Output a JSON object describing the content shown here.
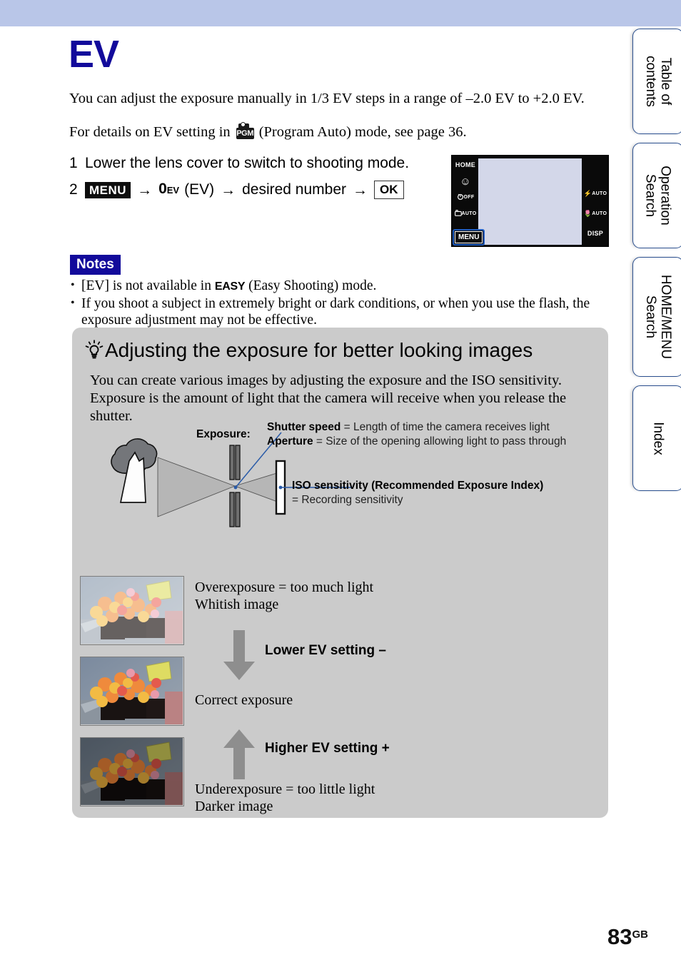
{
  "document": {
    "title": "EV",
    "page_number": "83",
    "page_region_suffix": "GB"
  },
  "intro": {
    "paragraph": "You can adjust the exposure manually in 1/3 EV steps in a range of –2.0 EV to +2.0 EV.",
    "pgm_prefix": "For details on EV setting in",
    "pgm_icon_label": "PGM",
    "pgm_suffix": "(Program Auto) mode, see page 36."
  },
  "steps": [
    {
      "num": "1",
      "text": "Lower the lens cover to switch to shooting mode."
    },
    {
      "num": "2",
      "menu_label": "MENU",
      "arrow": "→",
      "ev_zero": "0",
      "ev_unit": "EV",
      "ev_paren": "(EV)",
      "desired": "desired number",
      "ok_label": "OK"
    }
  ],
  "camera_screen": {
    "home_label": "HOME",
    "smile_label": "☺",
    "timer_label": "OFF",
    "burst_label": "AUTO",
    "flash_label": "AUTO",
    "macro_label": "AUTO",
    "disp_label": "DISP",
    "menu_label": "MENU"
  },
  "notes": {
    "heading": "Notes",
    "items": [
      "[EV] is not available in  (Easy Shooting) mode.",
      "If you shoot a subject in extremely bright or dark conditions, or when you use the flash, the exposure adjustment may not be effective."
    ],
    "note1_prefix": "[EV] is not available in",
    "note1_badge": "EASY",
    "note1_suffix": "(Easy Shooting) mode.",
    "note2": "If you shoot a subject in extremely bright or dark conditions, or when you use the flash, the exposure adjustment may not be effective."
  },
  "tip": {
    "title": "Adjusting the exposure for better looking images",
    "body": "You can create various images by adjusting the exposure and the ISO sensitivity. Exposure is the amount of light that the camera will receive when you release the shutter.",
    "diagram": {
      "exposure_label": "Exposure:",
      "shutter_bold": "Shutter speed",
      "shutter_rest": " = Length of time the camera receives light",
      "aperture_bold": "Aperture",
      "aperture_rest": " = Size of the opening allowing light to pass through",
      "iso_bold": "ISO sensitivity (Recommended Exposure Index)",
      "iso_rest": "= Recording sensitivity"
    },
    "examples": [
      {
        "caption_line1": "Overexposure = too much light",
        "caption_line2": "Whitish image"
      },
      {
        "caption_line1": "Correct exposure",
        "caption_line2": ""
      },
      {
        "caption_line1": "Underexposure = too little light",
        "caption_line2": "Darker image"
      }
    ],
    "arrows": [
      {
        "label": "Lower EV setting –",
        "direction": "down"
      },
      {
        "label": "Higher EV setting +",
        "direction": "up"
      }
    ]
  },
  "nav_tabs": [
    {
      "line1": "Table of",
      "line2": "contents"
    },
    {
      "line1": "Operation",
      "line2": "Search"
    },
    {
      "line1": "HOME/MENU",
      "line2": "Search"
    },
    {
      "line1": "Index",
      "line2": ""
    }
  ],
  "colors": {
    "header_band": "#b9c6e8",
    "title_blue": "#120a9b",
    "tip_box_gray": "#cbcbcb",
    "tab_border": "#2a4f8f",
    "highlight_blue": "#1d5bbf"
  }
}
